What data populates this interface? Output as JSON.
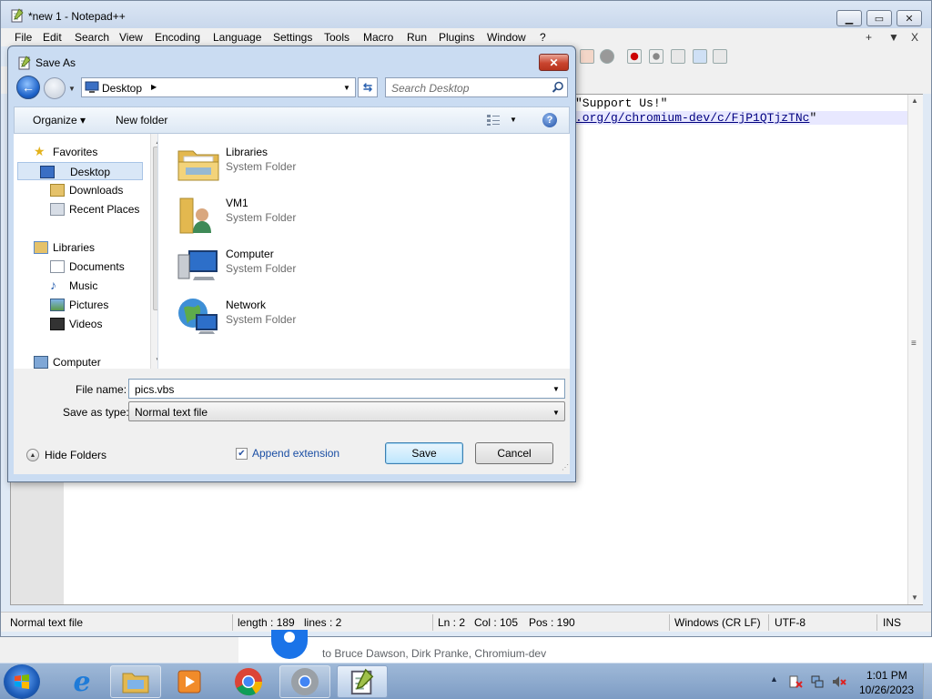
{
  "notepad": {
    "title": "*new 1 - Notepad++",
    "menu": [
      "File",
      "Edit",
      "Search",
      "View",
      "Encoding",
      "Language",
      "Settings",
      "Tools",
      "Macro",
      "Run",
      "Plugins",
      "Window",
      "?"
    ],
    "menu_right": [
      "+",
      "▼",
      "X"
    ],
    "code_line_1": "\"Support Us!\"",
    "code_line_2_link": ".org/g/chromium-dev/c/FjP1QTjzTNc",
    "code_line_2_tail": "\"",
    "status": {
      "file_type": "Normal text file",
      "length": "length : 189",
      "lines": "lines : 2",
      "ln": "Ln : 2",
      "col": "Col : 105",
      "pos": "Pos : 190",
      "eol": "Windows (CR LF)",
      "encoding": "UTF-8",
      "mode": "INS"
    }
  },
  "background": {
    "text": "to Bruce Dawson, Dirk Pranke, Chromium-dev"
  },
  "dialog": {
    "title": "Save As",
    "address": "Desktop",
    "search_placeholder": "Search Desktop",
    "organize": "Organize ▾",
    "new_folder": "New folder",
    "nav": {
      "favorites": "Favorites",
      "desktop": "Desktop",
      "downloads": "Downloads",
      "recent_places": "Recent Places",
      "libraries": "Libraries",
      "documents": "Documents",
      "music": "Music",
      "pictures": "Pictures",
      "videos": "Videos",
      "computer": "Computer"
    },
    "items": [
      {
        "name": "Libraries",
        "type": "System Folder"
      },
      {
        "name": "VM1",
        "type": "System Folder"
      },
      {
        "name": "Computer",
        "type": "System Folder"
      },
      {
        "name": "Network",
        "type": "System Folder"
      }
    ],
    "file_name_label": "File name:",
    "file_name_value": "pics.vbs",
    "save_as_type_label": "Save as type:",
    "save_as_type_value": "Normal text file",
    "hide_folders": "Hide Folders",
    "append_extension": "Append extension",
    "append_extension_checked": true,
    "save": "Save",
    "cancel": "Cancel"
  },
  "taskbar": {
    "time": "1:01 PM",
    "date": "10/26/2023",
    "icons": [
      "windows-start-icon",
      "internet-explorer-icon",
      "file-explorer-icon",
      "media-player-icon",
      "chrome-icon",
      "chrome-dev-icon",
      "notepad-plus-plus-icon"
    ]
  },
  "colors": {
    "accent": "#1a4ea4",
    "close_red": "#c9452f",
    "selection": "#d9e7f7"
  }
}
